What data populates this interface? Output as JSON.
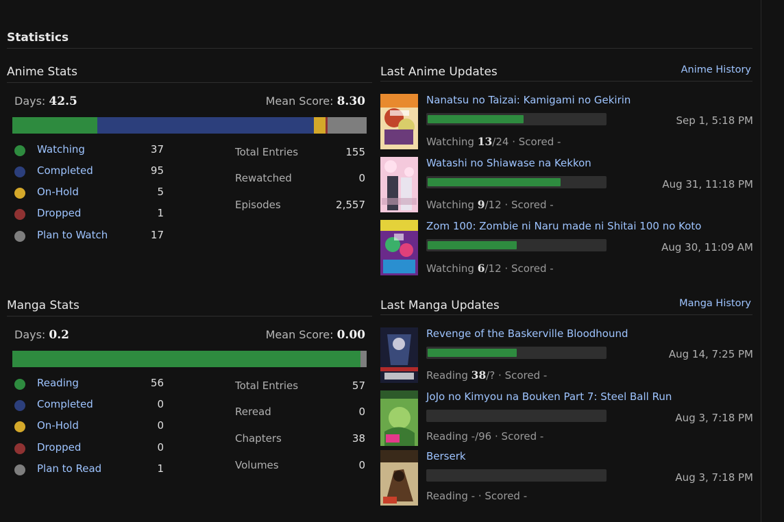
{
  "page_title": "Statistics",
  "colors": {
    "watching": "#2e8b3f",
    "completed": "#2c3f7c",
    "on_hold": "#d4a82a",
    "dropped": "#8f3232",
    "plan": "#7e7e7e",
    "link": "#9ec4ff"
  },
  "anime_stats": {
    "title": "Anime Stats",
    "days_label": "Days:",
    "days_value": "42.5",
    "mean_label": "Mean Score:",
    "mean_value": "8.30",
    "statuses": [
      {
        "label": "Watching",
        "count": "37"
      },
      {
        "label": "Completed",
        "count": "95"
      },
      {
        "label": "On-Hold",
        "count": "5"
      },
      {
        "label": "Dropped",
        "count": "1"
      },
      {
        "label": "Plan to Watch",
        "count": "17"
      }
    ],
    "totals": [
      {
        "label": "Total Entries",
        "value": "155"
      },
      {
        "label": "Rewatched",
        "value": "0"
      },
      {
        "label": "Episodes",
        "value": "2,557"
      }
    ]
  },
  "manga_stats": {
    "title": "Manga Stats",
    "days_label": "Days:",
    "days_value": "0.2",
    "mean_label": "Mean Score:",
    "mean_value": "0.00",
    "statuses": [
      {
        "label": "Reading",
        "count": "56"
      },
      {
        "label": "Completed",
        "count": "0"
      },
      {
        "label": "On-Hold",
        "count": "0"
      },
      {
        "label": "Dropped",
        "count": "0"
      },
      {
        "label": "Plan to Read",
        "count": "1"
      }
    ],
    "totals": [
      {
        "label": "Total Entries",
        "value": "57"
      },
      {
        "label": "Reread",
        "value": "0"
      },
      {
        "label": "Chapters",
        "value": "38"
      },
      {
        "label": "Volumes",
        "value": "0"
      }
    ]
  },
  "anime_updates": {
    "title": "Last Anime Updates",
    "history_link": "Anime History",
    "items": [
      {
        "title": "Nanatsu no Taizai: Kamigami no Gekirin",
        "date": "Sep 1, 5:18 PM",
        "status": "Watching",
        "progress": "13",
        "total": "/24",
        "scored": "· Scored -",
        "progress_fraction": 0.542
      },
      {
        "title": "Watashi no Shiawase na Kekkon",
        "date": "Aug 31, 11:18 PM",
        "status": "Watching",
        "progress": "9",
        "total": "/12",
        "scored": "· Scored -",
        "progress_fraction": 0.75
      },
      {
        "title": "Zom 100: Zombie ni Naru made ni Shitai 100 no Koto",
        "date": "Aug 30, 11:09 AM",
        "status": "Watching",
        "progress": "6",
        "total": "/12",
        "scored": "· Scored -",
        "progress_fraction": 0.5
      }
    ]
  },
  "manga_updates": {
    "title": "Last Manga Updates",
    "history_link": "Manga History",
    "items": [
      {
        "title": "Revenge of the Baskerville Bloodhound",
        "date": "Aug 14, 7:25 PM",
        "status": "Reading",
        "progress": "38",
        "total": "/?",
        "scored": "· Scored -",
        "progress_fraction": 0.5
      },
      {
        "title": "JoJo no Kimyou na Bouken Part 7: Steel Ball Run",
        "date": "Aug 3, 7:18 PM",
        "status": "Reading",
        "progress": "",
        "total": "-/96",
        "scored": "· Scored -",
        "progress_fraction": 0
      },
      {
        "title": "Berserk",
        "date": "Aug 3, 7:18 PM",
        "status": "Reading",
        "progress": "",
        "total": "- ·",
        "scored": "Scored -",
        "progress_fraction": 0
      }
    ]
  }
}
